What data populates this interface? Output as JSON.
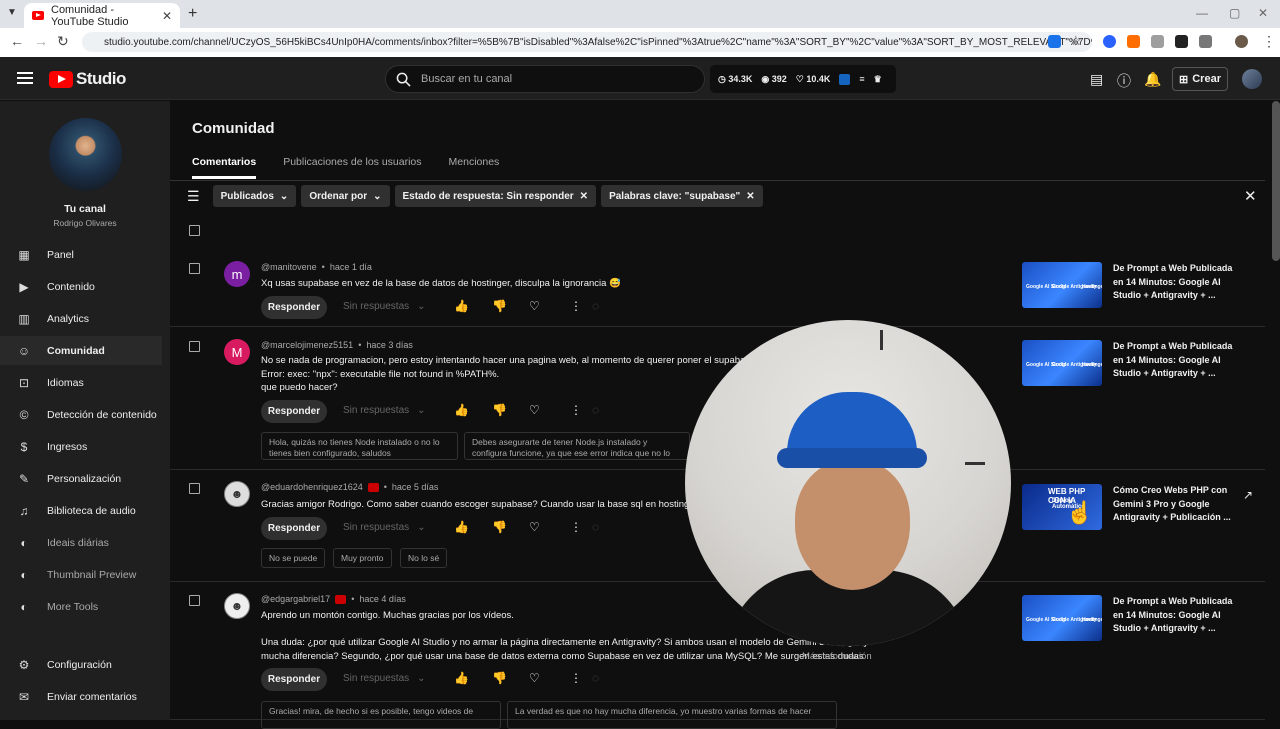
{
  "browser": {
    "tab_title": "Comunidad - YouTube Studio",
    "url": "studio.youtube.com/channel/UCzyOS_56H5kiBCs4UnIp0HA/comments/inbox?filter=%5B%7B\"isDisabled\"%3Afalse%2C\"isPinned\"%3Atrue%2C\"name\"%3A\"SORT_BY\"%2C\"value\"%3A\"SORT_BY_MOST_RELEVANT\"%7D%2C%7B\"n..."
  },
  "header": {
    "logo_text": "Studio",
    "search_placeholder": "Buscar en tu canal",
    "stats": {
      "subs": "34.3K",
      "views": "392",
      "likes": "10.4K"
    },
    "create_label": "Crear"
  },
  "sidebar": {
    "channel_label": "Tu canal",
    "channel_name": "Rodrigo Olivares",
    "items": [
      {
        "label": "Panel",
        "icon": "dashboard-icon"
      },
      {
        "label": "Contenido",
        "icon": "content-icon"
      },
      {
        "label": "Analytics",
        "icon": "analytics-icon"
      },
      {
        "label": "Comunidad",
        "icon": "community-icon"
      },
      {
        "label": "Idiomas",
        "icon": "subtitles-icon"
      },
      {
        "label": "Detección de contenido",
        "icon": "copyright-icon"
      },
      {
        "label": "Ingresos",
        "icon": "dollar-icon"
      },
      {
        "label": "Personalización",
        "icon": "magic-wand-icon"
      },
      {
        "label": "Biblioteca de audio",
        "icon": "audio-library-icon"
      },
      {
        "label": "Ideais diárias",
        "icon": "extension-icon"
      },
      {
        "label": "Thumbnail Preview",
        "icon": "extension-icon"
      },
      {
        "label": "More Tools",
        "icon": "extension-icon"
      },
      {
        "label": "Configuración",
        "icon": "gear-icon"
      },
      {
        "label": "Enviar comentarios",
        "icon": "feedback-icon"
      }
    ]
  },
  "page": {
    "title": "Comunidad",
    "tabs": [
      "Comentarios",
      "Publicaciones de los usuarios",
      "Menciones"
    ],
    "filters": {
      "published": "Publicados",
      "sort": "Ordenar por",
      "status": "Estado de respuesta: Sin responder",
      "keywords": "Palabras clave: \"supabase\""
    }
  },
  "labels": {
    "reply": "Responder",
    "no_replies": "Sin respuestas",
    "more_info": "Más información"
  },
  "comments": [
    {
      "author": "@manitovene",
      "time": "hace 1 día",
      "initial": "m",
      "avatar_color": "#7b1fa2",
      "lines": [
        "Xq usas supabase en vez de la base de datos de hostinger, disculpa la ignorancia 😅"
      ],
      "video": "De Prompt a Web Publicada en 14 Minutos: Google AI Studio + Antigravity + ..."
    },
    {
      "author": "@marcelojimenez5151",
      "time": "hace 3 días",
      "initial": "M",
      "avatar_color": "#d81b60",
      "lines": [
        "No se nada de programacion, pero estoy intentando hacer una pagina web, al momento de querer poner el supabase access t",
        "Error: exec: \"npx\": executable file not found in %PATH%.",
        "que puedo hacer?"
      ],
      "suggestions": [
        "Hola, quizás no tienes Node instalado o no lo tienes bien configurado, saludos",
        "Debes asegurarte de tener Node.js instalado y configura funcione, ya que ese error indica que no lo encuentra en"
      ],
      "video": "De Prompt a Web Publicada en 14 Minutos: Google AI Studio + Antigravity + ..."
    },
    {
      "author": "@eduardohenriquez1624",
      "time": "hace 5 días",
      "initial": "",
      "avatar_color": "#ddd",
      "lines": [
        "Gracias amigor Rodrigo. Como saber cuando escoger supabase? Cuando usar la base sql en hostinguer?"
      ],
      "quick_replies": [
        "No se puede",
        "Muy pronto",
        "No lo sé"
      ],
      "video": "Cómo Creo Webs PHP con Gemini 3 Pro y Google Antigravity + Publicación ..."
    },
    {
      "author": "@edgargabriel17",
      "time": "hace 4 días",
      "initial": "",
      "avatar_color": "#eee",
      "lines": [
        "Aprendo un montón contigo. Muchas gracias por los vídeos.",
        "",
        "Una duda: ¿por qué utilizar Google AI Studio y no armar la página directamente en Antigravity? Si ambos usan el modelo de Gemini 3 Pro, ¿hay",
        "mucha diferencia? Segundo, ¿por qué usar una base de datos externa como Supabase en vez de utilizar una MySQL? Me surgen estas dudas"
      ],
      "suggestions": [
        "Gracias! mira, de hecho si es posible, tengo videos de",
        "La verdad es que no hay mucha diferencia, yo muestro varias formas de hacer"
      ],
      "video": "De Prompt a Web Publicada en 14 Minutos: Google AI Studio + Antigravity + ..."
    }
  ],
  "thumb_text": {
    "a": "Google AI Studio",
    "b": "Google Antigravity",
    "c": "Hostinger",
    "php": "WEB PHP CON IA",
    "php2": "Deploy Automático"
  }
}
